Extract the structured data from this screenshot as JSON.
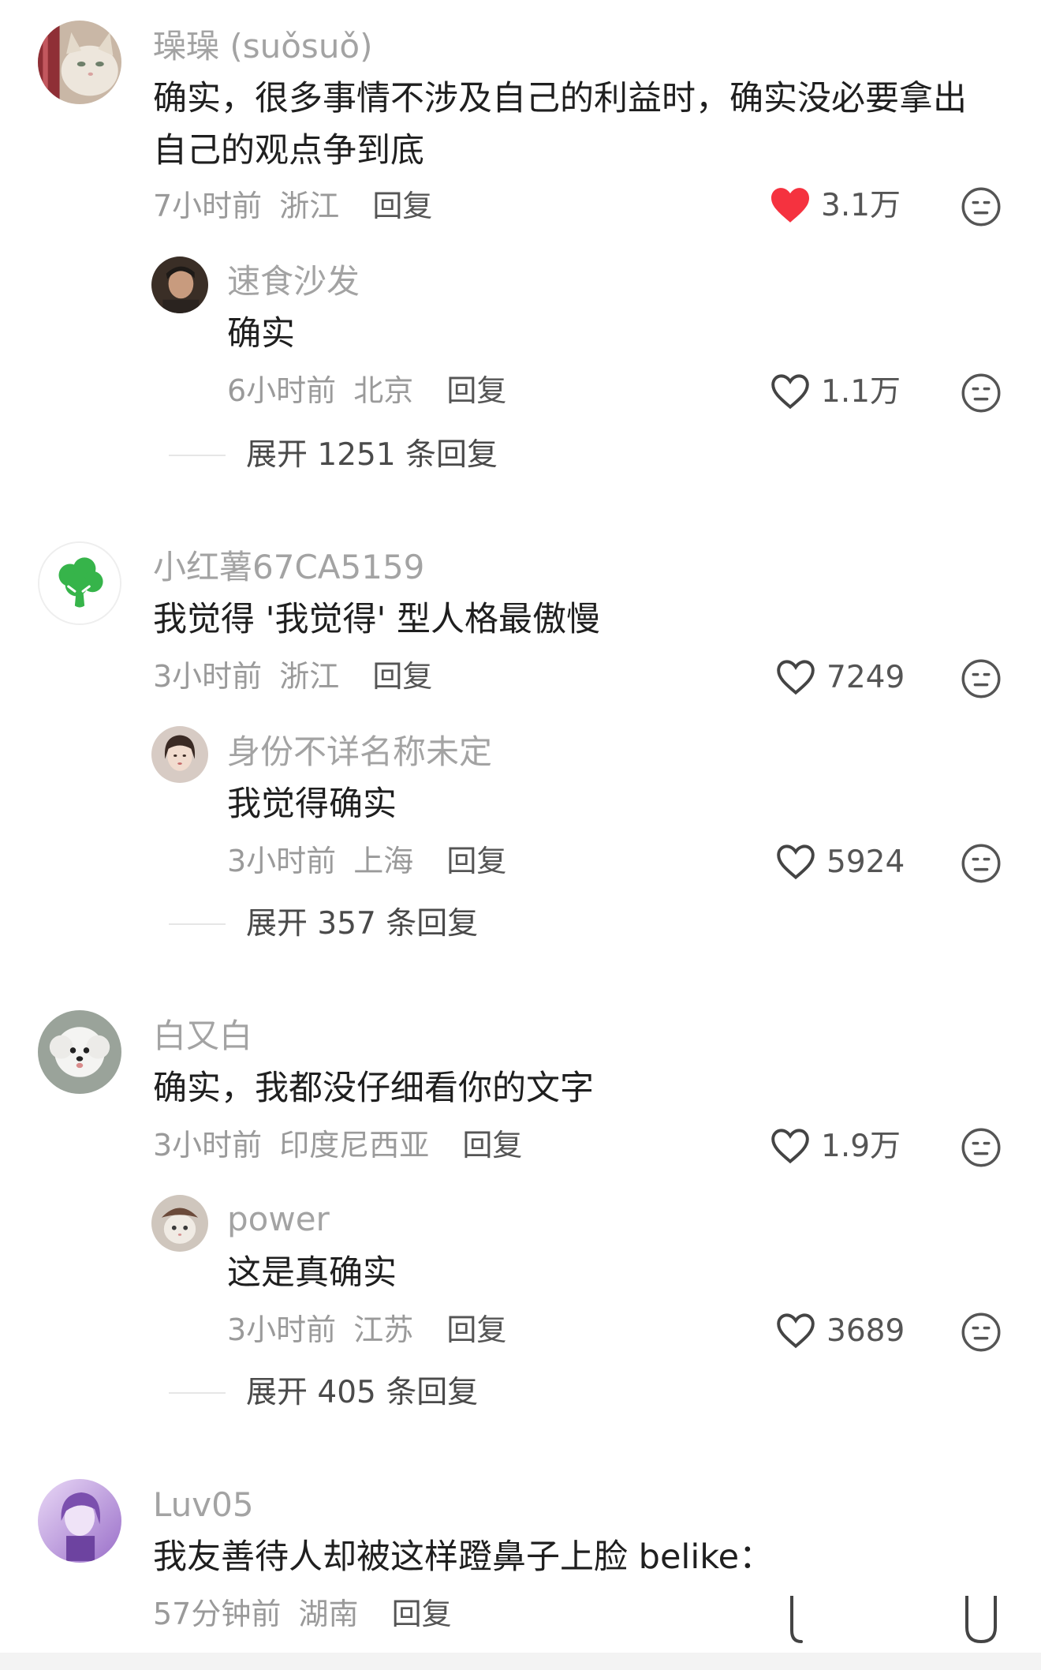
{
  "comments": [
    {
      "name": "璪璪 (suǒsuǒ)",
      "text": "确实，很多事情不涉及自己的利益时，确实没必要拿出自己的观点争到底",
      "time": "7小时前",
      "region": "浙江",
      "reply_label": "回复",
      "likes": "3.1万",
      "liked": true,
      "avatar_icon": "cat-avatar",
      "sub": {
        "name": "速食沙发",
        "text": "确实",
        "time": "6小时前",
        "region": "北京",
        "reply_label": "回复",
        "likes": "1.1万",
        "avatar_icon": "person-avatar"
      },
      "expand_label": "展开 1251 条回复"
    },
    {
      "name": "小红薯67CA5159",
      "text": "我觉得 '我觉得' 型人格最傲慢",
      "time": "3小时前",
      "region": "浙江",
      "reply_label": "回复",
      "likes": "7249",
      "liked": false,
      "avatar_icon": "broccoli-avatar",
      "sub": {
        "name": "身份不详名称未定",
        "text": "我觉得确实",
        "time": "3小时前",
        "region": "上海",
        "reply_label": "回复",
        "likes": "5924",
        "avatar_icon": "girl-avatar"
      },
      "expand_label": "展开 357 条回复"
    },
    {
      "name": "白又白",
      "text": "确实，我都没仔细看你的文字",
      "time": "3小时前",
      "region": "印度尼西亚",
      "reply_label": "回复",
      "likes": "1.9万",
      "liked": false,
      "avatar_icon": "white-dog-avatar",
      "sub": {
        "name": "power",
        "text": "这是真确实",
        "time": "3小时前",
        "region": "江苏",
        "reply_label": "回复",
        "likes": "3689",
        "avatar_icon": "cat-hat-avatar"
      },
      "expand_label": "展开 405 条回复"
    },
    {
      "name": "Luv05",
      "text": "我友善待人却被这样蹬鼻子上脸 belike：",
      "time": "57分钟前",
      "region": "湖南",
      "reply_label": "回复",
      "avatar_icon": "purple-anime-avatar"
    }
  ],
  "colors": {
    "liked_heart": "#f5323f",
    "name_gray": "#a3a3a3",
    "meta_gray": "#9a9a9a"
  }
}
